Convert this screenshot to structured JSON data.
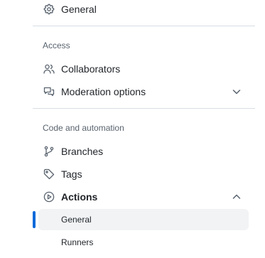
{
  "colors": {
    "active_indicator": "#0969da",
    "active_background": "#f1f3f5",
    "divider": "#d8dee4",
    "heading_text": "#59636e",
    "icon": "#59636e"
  },
  "sidebar": {
    "top_item": {
      "label": "General",
      "icon": "gear-icon"
    },
    "sections": [
      {
        "heading": "Access",
        "items": [
          {
            "label": "Collaborators",
            "icon": "people-icon"
          },
          {
            "label": "Moderation options",
            "icon": "comment-discussion-icon",
            "expandable": true,
            "expanded": false
          }
        ]
      },
      {
        "heading": "Code and automation",
        "items": [
          {
            "label": "Branches",
            "icon": "git-branch-icon"
          },
          {
            "label": "Tags",
            "icon": "tag-icon"
          },
          {
            "label": "Actions",
            "icon": "play-icon",
            "expandable": true,
            "expanded": true,
            "subitems": [
              {
                "label": "General",
                "active": true
              },
              {
                "label": "Runners",
                "active": false
              }
            ]
          }
        ]
      }
    ]
  }
}
